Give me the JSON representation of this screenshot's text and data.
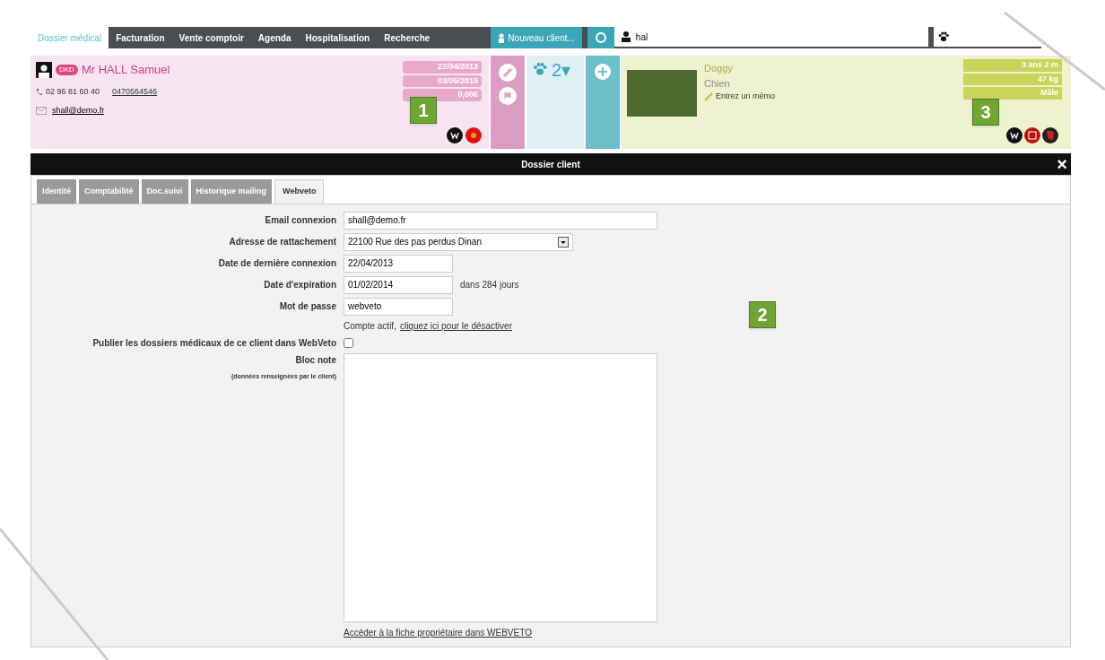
{
  "nav": {
    "tabs": [
      {
        "label": "Dossier médical",
        "selected": true
      },
      {
        "label": "Facturation",
        "selected": false
      },
      {
        "label": "Vente comptoir",
        "selected": false
      },
      {
        "label": "Agenda",
        "selected": false
      },
      {
        "label": "Hospitalisation",
        "selected": false
      },
      {
        "label": "Recherche",
        "selected": false
      }
    ],
    "new_client": "Nouveau client...",
    "search_value": "hal"
  },
  "client": {
    "badge": "DKD",
    "name": "Mr HALL Samuel",
    "phone": "02 96 81 60 40",
    "mobile": "0470564546",
    "email": "shall@demo.fr",
    "chips": [
      "22/04/2013",
      "03/05/2015",
      "0,00€"
    ],
    "animal_count": "2▾"
  },
  "animal": {
    "name": "Doggy",
    "species": "Chien",
    "memo": "Entrez un mémo",
    "chips": [
      "3 ans 2 m",
      "47 kg",
      "Mâle"
    ]
  },
  "callouts": [
    "1",
    "2",
    "3"
  ],
  "dialog": {
    "title": "Dossier client",
    "close": "×",
    "tabs": [
      {
        "label": "Identité",
        "selected": false
      },
      {
        "label": "Comptabilité",
        "selected": false
      },
      {
        "label": "Doc.suivi",
        "selected": false
      },
      {
        "label": "Historique mailing",
        "selected": false
      },
      {
        "label": "Webveto",
        "selected": true
      }
    ],
    "fields": [
      {
        "label": "Email connexion",
        "kind": "text",
        "value": "shall@demo.fr"
      },
      {
        "label": "Adresse de rattachement",
        "kind": "select",
        "value": "22100 Rue des pas perdus Dinan"
      },
      {
        "label": "Date de dernière connexion",
        "kind": "short",
        "value": "22/04/2013"
      },
      {
        "label": "Date d'expiration",
        "kind": "short",
        "value": "01/02/2014",
        "suffix": "dans 284 jours"
      },
      {
        "label": "Mot de passe",
        "kind": "short",
        "value": "webveto"
      }
    ],
    "account_status": "Compte actif,",
    "account_link": "cliquez ici pour le désactiver",
    "publish": {
      "label": "Publier les dossiers médicaux de ce client dans WebVeto",
      "checked": false
    },
    "note": {
      "label": "Bloc note",
      "hint": "(données renseignées par le client)"
    },
    "footer_link": "Accéder à la fiche propriétaire dans WEBVETO"
  }
}
